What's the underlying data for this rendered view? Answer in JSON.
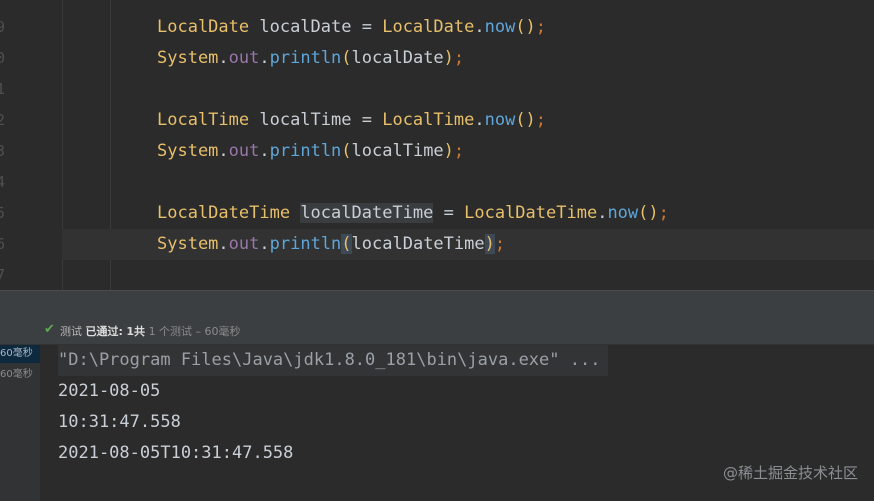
{
  "editor": {
    "line_numbers": [
      "9",
      "0",
      "1",
      "2",
      "3",
      "4",
      "5",
      "6",
      "7"
    ],
    "lines": [
      {
        "tokens": [
          {
            "t": "LocalDate",
            "c": "cls"
          },
          {
            "t": " localDate ",
            "c": "var"
          },
          {
            "t": "=",
            "c": "op"
          },
          {
            "t": " ",
            "c": "var"
          },
          {
            "t": "LocalDate",
            "c": "cls"
          },
          {
            "t": ".",
            "c": "op"
          },
          {
            "t": "now",
            "c": "mth"
          },
          {
            "t": "()",
            "c": "paren"
          },
          {
            "t": ";",
            "c": "punc"
          }
        ]
      },
      {
        "tokens": [
          {
            "t": "System",
            "c": "cls"
          },
          {
            "t": ".",
            "c": "op"
          },
          {
            "t": "out",
            "c": "fld"
          },
          {
            "t": ".",
            "c": "op"
          },
          {
            "t": "println",
            "c": "mth"
          },
          {
            "t": "(",
            "c": "paren"
          },
          {
            "t": "localDate",
            "c": "var"
          },
          {
            "t": ")",
            "c": "paren"
          },
          {
            "t": ";",
            "c": "punc"
          }
        ]
      },
      {
        "tokens": []
      },
      {
        "tokens": [
          {
            "t": "LocalTime",
            "c": "cls"
          },
          {
            "t": " localTime ",
            "c": "var"
          },
          {
            "t": "=",
            "c": "op"
          },
          {
            "t": " ",
            "c": "var"
          },
          {
            "t": "LocalTime",
            "c": "cls"
          },
          {
            "t": ".",
            "c": "op"
          },
          {
            "t": "now",
            "c": "mth"
          },
          {
            "t": "()",
            "c": "paren"
          },
          {
            "t": ";",
            "c": "punc"
          }
        ]
      },
      {
        "tokens": [
          {
            "t": "System",
            "c": "cls"
          },
          {
            "t": ".",
            "c": "op"
          },
          {
            "t": "out",
            "c": "fld"
          },
          {
            "t": ".",
            "c": "op"
          },
          {
            "t": "println",
            "c": "mth"
          },
          {
            "t": "(",
            "c": "paren"
          },
          {
            "t": "localTime",
            "c": "var"
          },
          {
            "t": ")",
            "c": "paren"
          },
          {
            "t": ";",
            "c": "punc"
          }
        ]
      },
      {
        "tokens": []
      },
      {
        "tokens": [
          {
            "t": "LocalDateTime",
            "c": "cls"
          },
          {
            "t": " ",
            "c": "var"
          },
          {
            "t": "localDateTime",
            "c": "var hl-var"
          },
          {
            "t": " ",
            "c": "var"
          },
          {
            "t": "=",
            "c": "op"
          },
          {
            "t": " ",
            "c": "var"
          },
          {
            "t": "LocalDateTime",
            "c": "cls"
          },
          {
            "t": ".",
            "c": "op"
          },
          {
            "t": "now",
            "c": "mth"
          },
          {
            "t": "()",
            "c": "paren"
          },
          {
            "t": ";",
            "c": "punc"
          }
        ]
      },
      {
        "tokens": [
          {
            "t": "System",
            "c": "cls"
          },
          {
            "t": ".",
            "c": "op"
          },
          {
            "t": "out",
            "c": "fld"
          },
          {
            "t": ".",
            "c": "op"
          },
          {
            "t": "println",
            "c": "mth"
          },
          {
            "t": "(",
            "c": "paren hl-paren"
          },
          {
            "t": "localDateTime",
            "c": "var"
          },
          {
            "t": ")",
            "c": "paren hl-paren"
          },
          {
            "t": ";",
            "c": "punc"
          }
        ]
      },
      {
        "tokens": []
      }
    ]
  },
  "test_status": {
    "label_test": "测试",
    "label_passed": "已通过:",
    "passed_count": "1共",
    "summary": "1 个测试 – 60毫秒"
  },
  "test_tree": {
    "items": [
      "60毫秒",
      "60毫秒"
    ]
  },
  "console": {
    "lines": [
      "\"D:\\Program Files\\Java\\jdk1.8.0_181\\bin\\java.exe\" ...",
      "2021-08-05",
      "10:31:47.558",
      "2021-08-05T10:31:47.558"
    ]
  },
  "watermark": "@稀土掘金技术社区",
  "colors": {
    "background": "#2b2b2b",
    "class": "#e8bf6a",
    "method": "#5ea6d9",
    "field": "#9876aa",
    "punctuation": "#cc7832",
    "pass_green": "#5fa854"
  }
}
